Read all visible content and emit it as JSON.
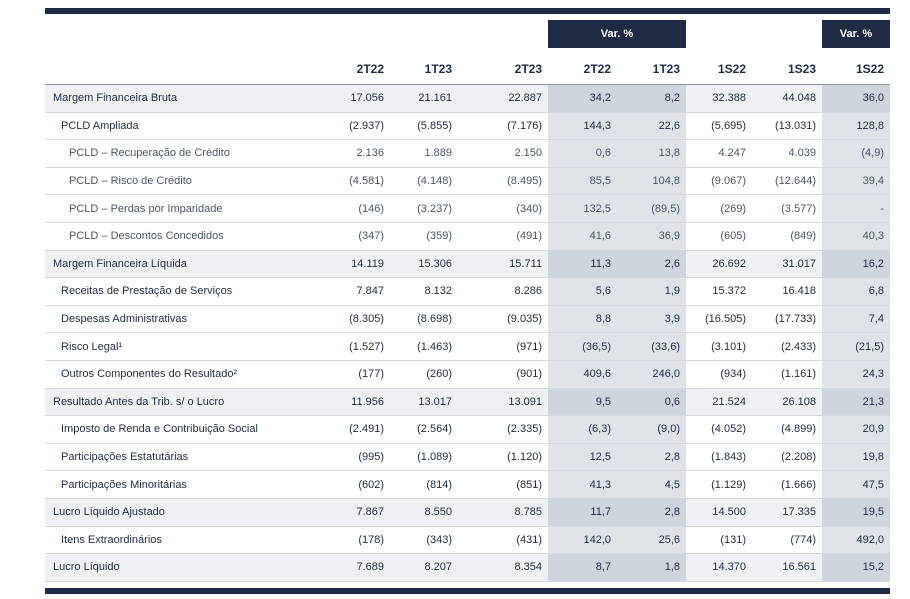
{
  "var_header_1": "Var. %",
  "var_header_2": "Var. %",
  "columns": [
    "2T22",
    "1T23",
    "2T23",
    "2T22",
    "1T23",
    "1S22",
    "1S23",
    "1S22"
  ],
  "rows": [
    {
      "label": "Margem Financeira Bruta",
      "values": [
        "17.056",
        "21.161",
        "22.887",
        "34,2",
        "8,2",
        "32.388",
        "44.048",
        "36,0"
      ]
    },
    {
      "label": "PCLD Ampliada",
      "values": [
        "(2.937)",
        "(5.855)",
        "(7.176)",
        "144,3",
        "22,6",
        "(5.695)",
        "(13.031)",
        "128,8"
      ]
    },
    {
      "label": "PCLD – Recuperação de Crédito",
      "values": [
        "2.136",
        "1.889",
        "2.150",
        "0,6",
        "13,8",
        "4.247",
        "4.039",
        "(4,9)"
      ]
    },
    {
      "label": "PCLD – Risco de Crédito",
      "values": [
        "(4.581)",
        "(4.148)",
        "(8.495)",
        "85,5",
        "104,8",
        "(9.067)",
        "(12.644)",
        "39,4"
      ]
    },
    {
      "label": "PCLD – Perdas por Imparidade",
      "values": [
        "(146)",
        "(3.237)",
        "(340)",
        "132,5",
        "(89,5)",
        "(269)",
        "(3.577)",
        "-"
      ]
    },
    {
      "label": "PCLD – Descontos Concedidos",
      "values": [
        "(347)",
        "(359)",
        "(491)",
        "41,6",
        "36,9",
        "(605)",
        "(849)",
        "40,3"
      ]
    },
    {
      "label": "Margem Financeira Líquida",
      "values": [
        "14.119",
        "15.306",
        "15.711",
        "11,3",
        "2,6",
        "26.692",
        "31.017",
        "16,2"
      ]
    },
    {
      "label": "Receitas de Prestação de Serviços",
      "values": [
        "7.847",
        "8.132",
        "8.286",
        "5,6",
        "1,9",
        "15.372",
        "16.418",
        "6,8"
      ]
    },
    {
      "label": "Despesas Administrativas",
      "values": [
        "(8.305)",
        "(8.698)",
        "(9.035)",
        "8,8",
        "3,9",
        "(16.505)",
        "(17.733)",
        "7,4"
      ]
    },
    {
      "label": "Risco Legal¹",
      "values": [
        "(1.527)",
        "(1.463)",
        "(971)",
        "(36,5)",
        "(33,6)",
        "(3.101)",
        "(2.433)",
        "(21,5)"
      ]
    },
    {
      "label": "Outros Componentes do Resultado²",
      "values": [
        "(177)",
        "(260)",
        "(901)",
        "409,6",
        "246,0",
        "(934)",
        "(1.161)",
        "24,3"
      ]
    },
    {
      "label": "Resultado Antes da Trib. s/ o Lucro",
      "values": [
        "11.956",
        "13.017",
        "13.091",
        "9,5",
        "0,6",
        "21.524",
        "26.108",
        "21,3"
      ]
    },
    {
      "label": "Imposto de Renda e Contribuição Social",
      "values": [
        "(2.491)",
        "(2.564)",
        "(2.335)",
        "(6,3)",
        "(9,0)",
        "(4.052)",
        "(4.899)",
        "20,9"
      ]
    },
    {
      "label": "Participações Estatutárias",
      "values": [
        "(995)",
        "(1.089)",
        "(1.120)",
        "12,5",
        "2,8",
        "(1.843)",
        "(2.208)",
        "19,8"
      ]
    },
    {
      "label": "Participações Minoritárias",
      "values": [
        "(602)",
        "(814)",
        "(851)",
        "41,3",
        "4,5",
        "(1.129)",
        "(1.666)",
        "47,5"
      ]
    },
    {
      "label": "Lucro Líquido Ajustado",
      "values": [
        "7.867",
        "8.550",
        "8.785",
        "11,7",
        "2,8",
        "14.500",
        "17.335",
        "19,5"
      ]
    },
    {
      "label": "Itens Extraordinários",
      "values": [
        "(178)",
        "(343)",
        "(431)",
        "142,0",
        "25,6",
        "(131)",
        "(774)",
        "492,0"
      ]
    },
    {
      "label": "Lucro Líquido",
      "values": [
        "7.689",
        "8.207",
        "8.354",
        "8,7",
        "1,8",
        "14.370",
        "16.561",
        "15,2"
      ]
    }
  ],
  "colors": {
    "navy": "#1f2a44",
    "shade": "#dfe3e8",
    "subtotal": "#eef0f3"
  }
}
